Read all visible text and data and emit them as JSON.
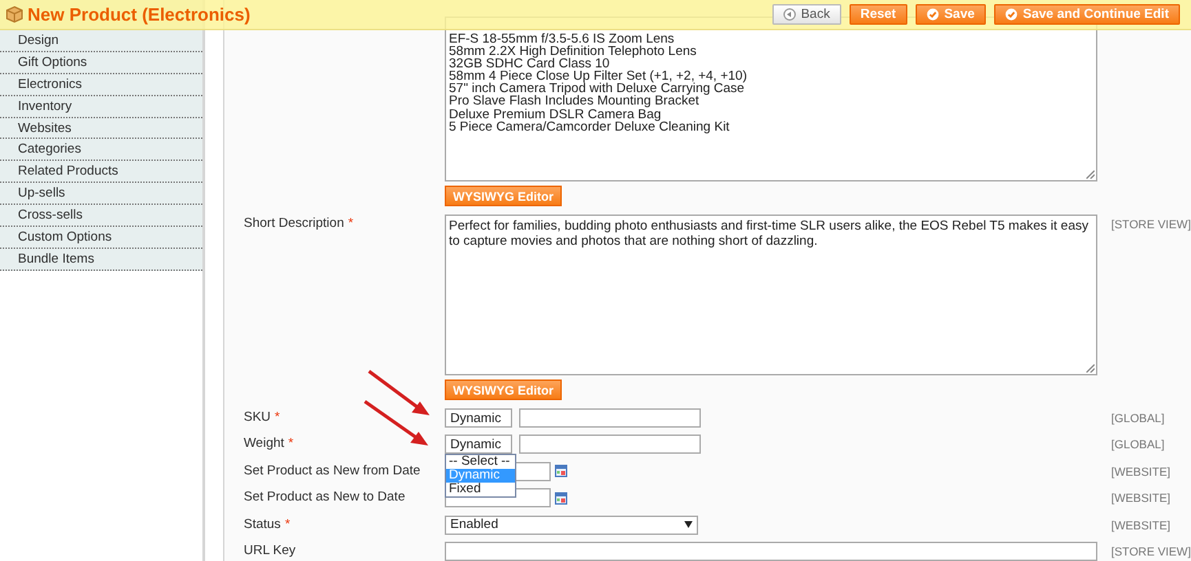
{
  "header": {
    "title": "New Product (Electronics)",
    "buttons": [
      {
        "label": "Back",
        "kind": "back"
      },
      {
        "label": "Reset",
        "kind": "plain"
      },
      {
        "label": "Save",
        "kind": "check"
      },
      {
        "label": "Save and Continue Edit",
        "kind": "check"
      }
    ]
  },
  "sidebar": {
    "items": [
      "Design",
      "Gift Options",
      "Electronics",
      "Inventory",
      "Websites",
      "Categories",
      "Related Products",
      "Up-sells",
      "Cross-sells",
      "Custom Options",
      "Bundle Items"
    ]
  },
  "form": {
    "rows": [
      {
        "kind": "textarea",
        "value": "EF-S 18-55mm f/3.5-5.6 IS Zoom Lens\n58mm 2.2X High Definition Telephoto Lens\n32GB SDHC Card Class 10\n58mm 4 Piece Close Up Filter Set (+1, +2, +4, +10)\n57\" inch Camera Tripod with Deluxe Carrying Case\nPro Slave Flash Includes Mounting Bracket\nDeluxe Premium DSLR Camera Bag\n5 Piece Camera/Camcorder Deluxe Cleaning Kit",
        "editor_button": "WYSIWYG Editor"
      },
      {
        "kind": "textarea",
        "label": "Short Description",
        "required_mark": "*",
        "value": "Perfect for families, budding photo enthusiasts and first-time SLR users alike, the EOS Rebel T5 makes it easy to capture movies and photos that are nothing short of dazzling.",
        "scope": "[STORE VIEW]",
        "editor_button": "WYSIWYG Editor"
      },
      {
        "kind": "typed",
        "label": "SKU",
        "required_mark": "*",
        "type": "Dynamic",
        "scope": "[GLOBAL]"
      },
      {
        "kind": "typed",
        "label": "Weight",
        "required_mark": "*",
        "type": "Dynamic",
        "scope": "[GLOBAL]",
        "options": [
          {
            "label": "-- Select --",
            "selected": false
          },
          {
            "label": "Dynamic",
            "selected": true
          },
          {
            "label": "Fixed",
            "selected": false
          }
        ]
      },
      {
        "kind": "date",
        "label": "Set Product as New from Date",
        "scope": "[WEBSITE]"
      },
      {
        "kind": "date",
        "label": "Set Product as New to Date",
        "scope": "[WEBSITE]"
      },
      {
        "kind": "select",
        "label": "Status",
        "required_mark": "*",
        "value": "Enabled",
        "scope": "[WEBSITE]"
      },
      {
        "kind": "text",
        "label": "URL Key",
        "scope": "[STORE VIEW]"
      }
    ]
  }
}
